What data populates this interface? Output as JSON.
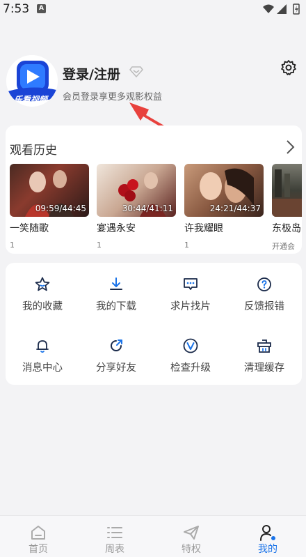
{
  "status_bar": {
    "time": "7:53",
    "notif_letter": "A"
  },
  "profile": {
    "title": "登录/注册",
    "subtitle": "会员登录享更多观影权益",
    "avatar_text": "乐看视频"
  },
  "history": {
    "title": "观看历史",
    "items": [
      {
        "title": "一笑随歌",
        "time": "09:59/44:45",
        "sub": "1"
      },
      {
        "title": "宴遇永安",
        "time": "30:44/41:11",
        "sub": "1"
      },
      {
        "title": "许我耀眼",
        "time": "24:21/44:37",
        "sub": "1"
      },
      {
        "title": "东极岛",
        "time": "",
        "sub": "开通会"
      }
    ]
  },
  "tools": [
    {
      "label": "我的收藏",
      "icon": "star-icon"
    },
    {
      "label": "我的下载",
      "icon": "download-icon"
    },
    {
      "label": "求片找片",
      "icon": "chat-icon"
    },
    {
      "label": "反馈报错",
      "icon": "question-icon"
    },
    {
      "label": "消息中心",
      "icon": "bell-icon"
    },
    {
      "label": "分享好友",
      "icon": "share-icon"
    },
    {
      "label": "检查升级",
      "icon": "upgrade-icon"
    },
    {
      "label": "清理缓存",
      "icon": "clean-icon"
    }
  ],
  "nav": [
    {
      "label": "首页",
      "icon": "home-icon"
    },
    {
      "label": "周表",
      "icon": "list-icon"
    },
    {
      "label": "特权",
      "icon": "send-icon"
    },
    {
      "label": "我的",
      "icon": "user-icon",
      "active": true
    }
  ],
  "colors": {
    "accent": "#1a73e8",
    "annotation": "#e8413d"
  }
}
